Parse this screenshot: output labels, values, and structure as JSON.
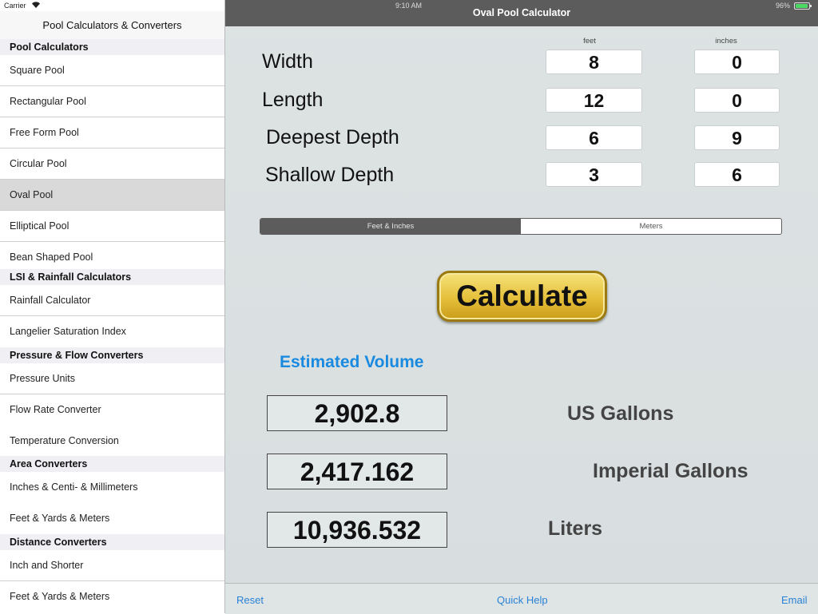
{
  "status": {
    "carrier": "Carrier",
    "time": "9:10 AM",
    "battery": "96%",
    "battery_level": 0.96
  },
  "sidebar": {
    "title": "Pool Calculators & Converters",
    "sections": [
      {
        "header": "Pool Calculators",
        "items": [
          "Square Pool",
          "Rectangular Pool",
          "Free Form Pool",
          "Circular Pool",
          "Oval Pool",
          "Elliptical Pool",
          "Bean Shaped Pool"
        ]
      },
      {
        "header": "LSI & Rainfall Calculators",
        "items": [
          "Rainfall Calculator",
          "Langelier Saturation Index"
        ]
      },
      {
        "header": "Pressure & Flow Converters",
        "items": [
          "Pressure Units",
          "Flow Rate Converter",
          "Temperature Conversion"
        ]
      },
      {
        "header": "Area Converters",
        "items": [
          "Inches & Centi- & Millimeters",
          "Feet & Yards & Meters"
        ]
      },
      {
        "header": "Distance Converters",
        "items": [
          "Inch and Shorter",
          "Feet & Yards & Meters"
        ]
      }
    ],
    "selected": "Oval Pool"
  },
  "nav": {
    "title": "Oval Pool Calculator"
  },
  "inputs": {
    "col_feet": "feet",
    "col_inches": "inches",
    "rows": [
      {
        "label": "Width",
        "feet": "8",
        "inches": "0"
      },
      {
        "label": "Length",
        "feet": "12",
        "inches": "0"
      },
      {
        "label": "Deepest Depth",
        "feet": "6",
        "inches": "9"
      },
      {
        "label": "Shallow Depth",
        "feet": "3",
        "inches": "6"
      }
    ]
  },
  "units_toggle": {
    "options": [
      "Feet & Inches",
      "Meters"
    ],
    "selected": "Feet & Inches"
  },
  "calculate_label": "Calculate",
  "results": {
    "heading": "Estimated Volume",
    "rows": [
      {
        "value": "2,902.8",
        "unit": "US Gallons"
      },
      {
        "value": "2,417.162",
        "unit": "Imperial Gallons"
      },
      {
        "value": "10,936.532",
        "unit": "Liters"
      }
    ]
  },
  "toolbar": {
    "reset": "Reset",
    "help": "Quick Help",
    "email": "Email"
  },
  "colors": {
    "accent": "#1a8ae0",
    "link": "#2a82d6",
    "navbar": "#5c5c5c",
    "button_gold": "#e5c03a"
  }
}
